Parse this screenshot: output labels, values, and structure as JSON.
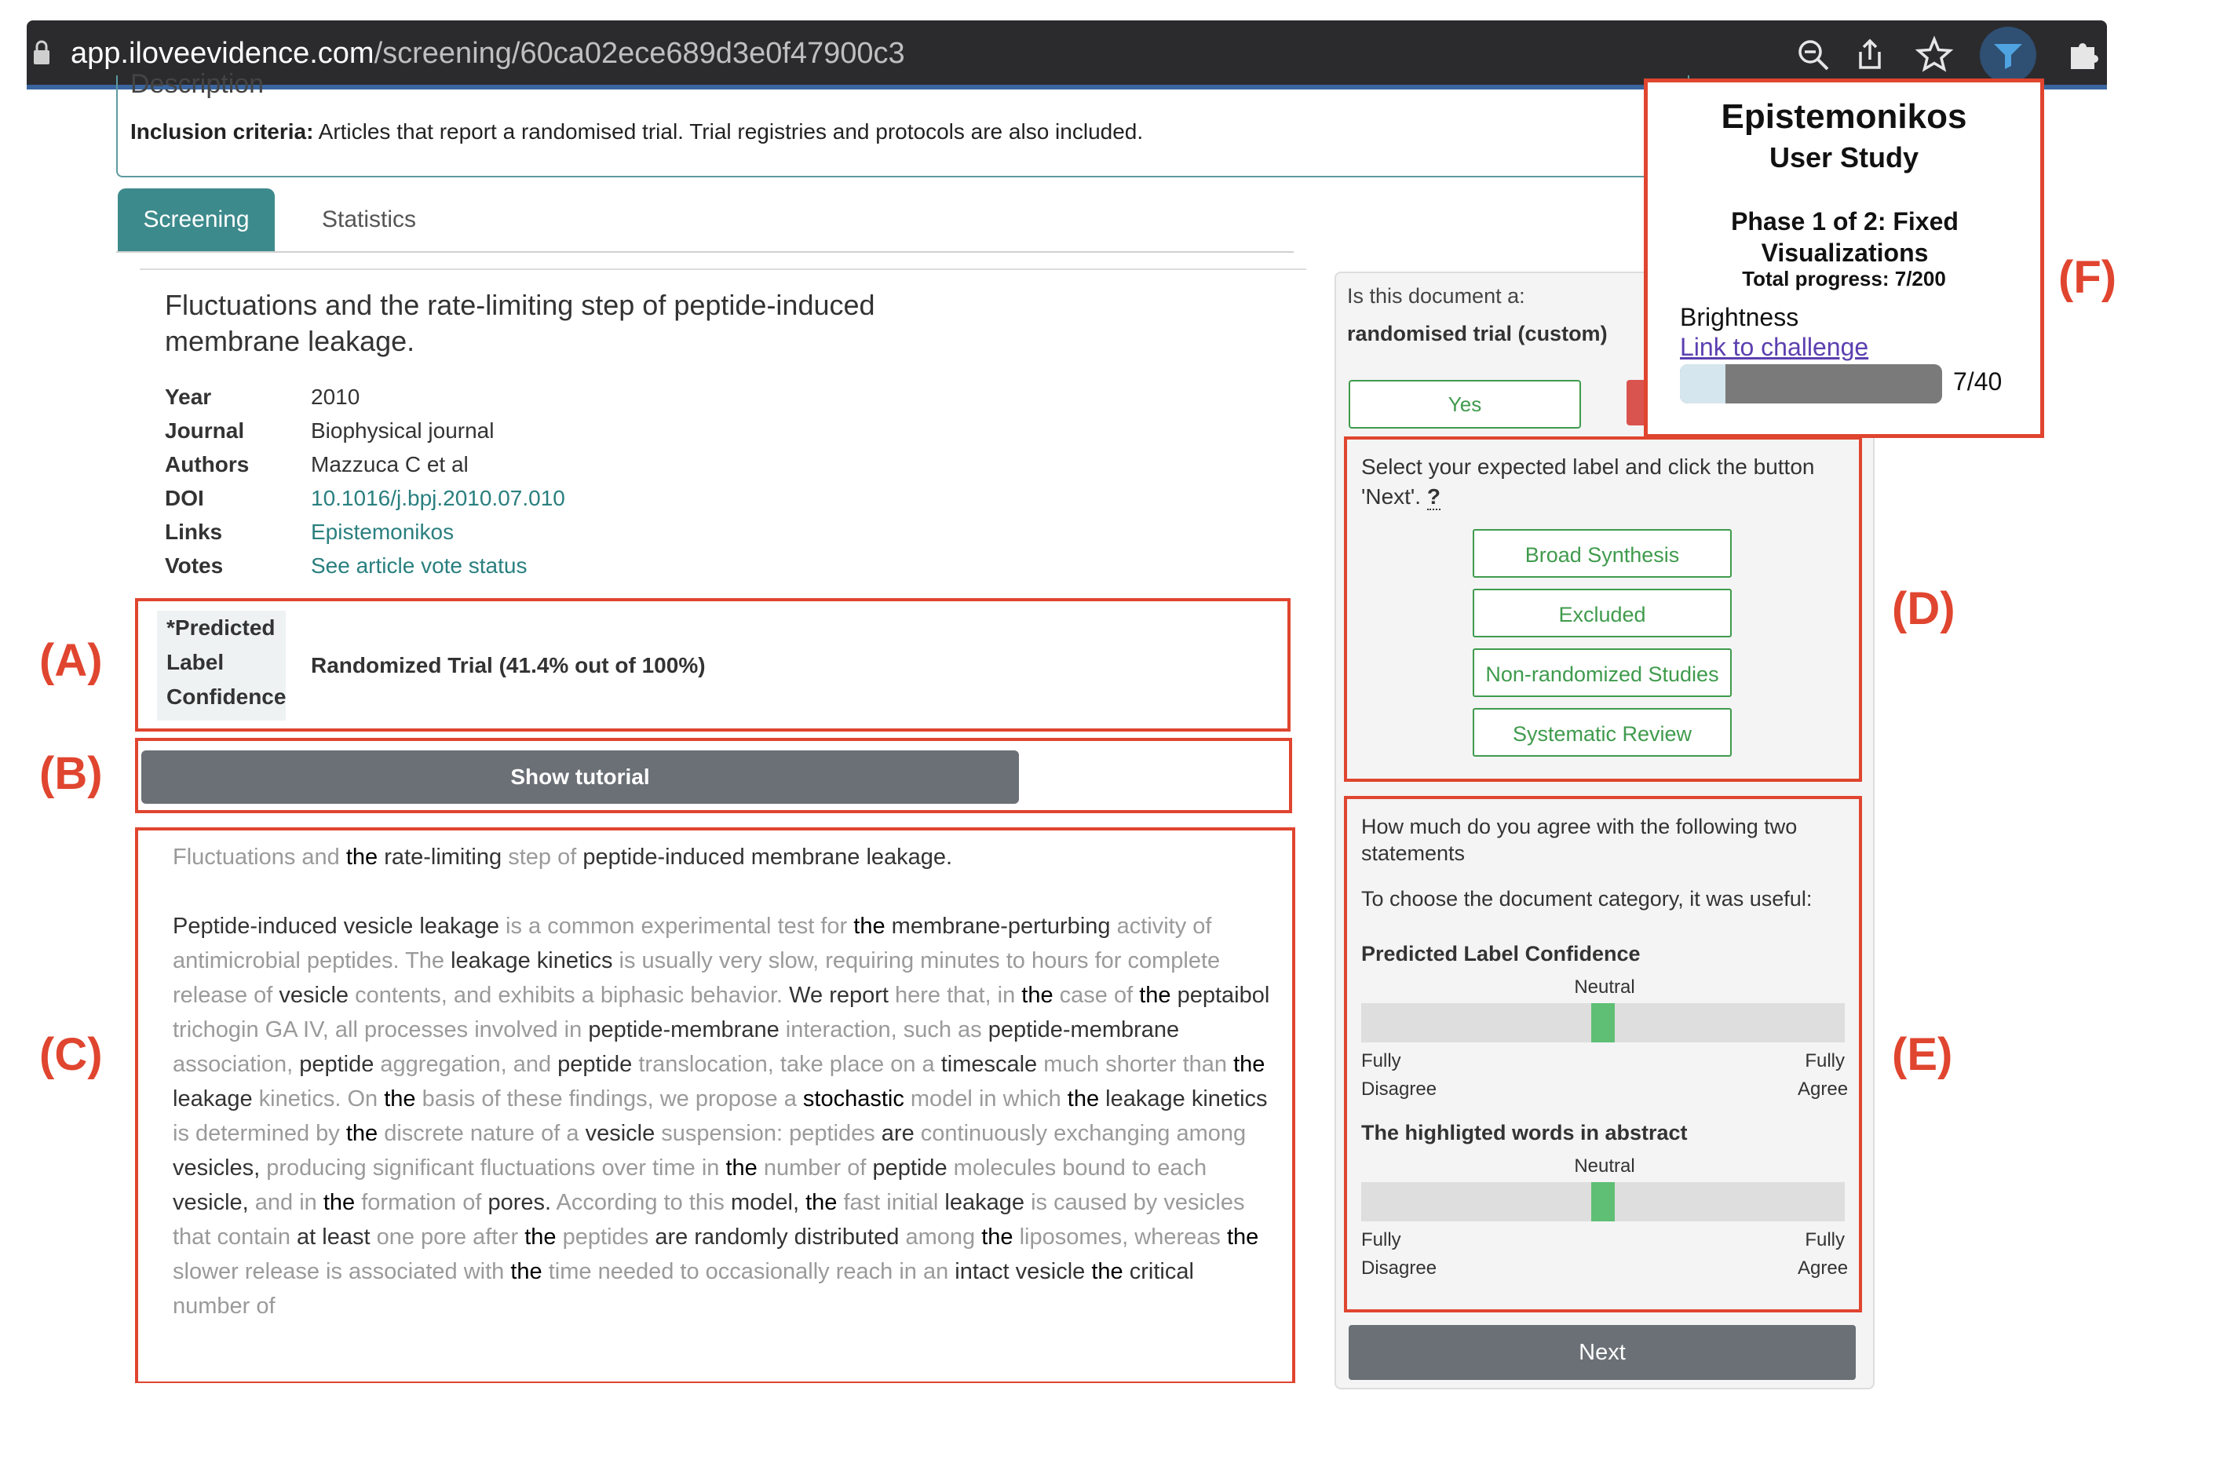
{
  "browser": {
    "url_host": "app.iloveevidence.com",
    "url_path": "/screening/60ca02ece689d3e0f47900c3",
    "toolbar_icons": [
      "zoom-out-icon",
      "share-icon",
      "star-icon",
      "extension-active-icon",
      "puzzle-icon"
    ]
  },
  "description": {
    "heading": "Description",
    "inclusion_label": "Inclusion criteria:",
    "inclusion_text": " Articles that report a randomised trial. Trial registries and protocols are also included."
  },
  "tabs": [
    {
      "label": "Screening",
      "active": true
    },
    {
      "label": "Statistics",
      "active": false
    }
  ],
  "article": {
    "title": "Fluctuations and the rate-limiting step of peptide-induced membrane leakage.",
    "meta": [
      {
        "key": "Year",
        "value": "2010",
        "link": false
      },
      {
        "key": "Journal",
        "value": "Biophysical journal",
        "link": false
      },
      {
        "key": "Authors",
        "value": "Mazzuca C et al",
        "link": false
      },
      {
        "key": "DOI",
        "value": "10.1016/j.bpj.2010.07.010",
        "link": true
      },
      {
        "key": "Links",
        "value": "Epistemonikos",
        "link": true
      },
      {
        "key": "Votes",
        "value": "See article vote status",
        "link": true
      }
    ]
  },
  "prediction": {
    "label_lines": [
      "*Predicted",
      "Label",
      "Confidence"
    ],
    "value": "Randomized Trial (41.4% out of 100%)"
  },
  "tutorial_button": "Show tutorial",
  "abstract": {
    "title": "Fluctuations and the rate-limiting step of peptide-induced membrane leakage.",
    "text": "Peptide-induced vesicle leakage is a common experimental test for the membrane-perturbing activity of antimicrobial peptides. The leakage kinetics is usually very slow, requiring minutes to hours for complete release of vesicle contents, and exhibits a biphasic behavior. We report here that, in the case of the peptaibol trichogin GA IV, all processes involved in peptide-membrane interaction, such as peptide-membrane association, peptide aggregation, and peptide translocation, take place on a timescale much shorter than the leakage kinetics. On the basis of these findings, we propose a stochastic model in which the leakage kinetics is determined by the discrete nature of a vesicle suspension: peptides are continuously exchanging among vesicles, producing significant fluctuations over time in the number of peptide molecules bound to each vesicle, and in the formation of pores. According to this model, the fast initial leakage is caused by vesicles that contain at least one pore after the peptides are randomly distributed among the liposomes, whereas the slower release is associated with the time needed to occasionally reach in an intact vesicle the critical number of",
    "highlight_strong": [
      "stochastic",
      "the"
    ],
    "highlight_dark": [
      "rate-limiting",
      "peptide-induced",
      "membrane",
      "leakage.",
      "Peptide-induced",
      "vesicle",
      "membrane-perturbing",
      "vesicle",
      "We",
      "report",
      "peptaibol",
      "peptide-membrane",
      "peptide-membrane",
      "peptide",
      "timescale",
      "leakage",
      "kinetics",
      "at",
      "least",
      "are",
      "randomly",
      "distributed",
      "vesicles,",
      "vesicle,",
      "pores.",
      "model,",
      "peptide",
      "intact",
      "vesicle",
      "critical"
    ]
  },
  "labeling": {
    "question": "Is this document a:",
    "category": "randomised trial (custom)",
    "yes_label": "Yes",
    "instruction": "Select your expected label and click the button 'Next'.",
    "help_glyph": "?",
    "options": [
      "Broad Synthesis",
      "Excluded",
      "Non-randomized Studies",
      "Systematic Review"
    ]
  },
  "survey": {
    "intro": "How much do you agree with the following two statements",
    "lead": "To choose the document category, it was useful:",
    "items": [
      {
        "title": "Predicted Label Confidence",
        "neutral": "Neutral",
        "left": [
          "Fully",
          "Disagree"
        ],
        "right": [
          "Fully",
          "Agree"
        ],
        "value": 0.5
      },
      {
        "title": "The highligted words in abstract",
        "neutral": "Neutral",
        "left": [
          "Fully",
          "Disagree"
        ],
        "right": [
          "Fully",
          "Agree"
        ],
        "value": 0.5
      }
    ],
    "next_label": "Next"
  },
  "study_overlay": {
    "title": "Epistemonikos",
    "subtitle": "User Study",
    "phase": "Phase 1 of 2: Fixed Visualizations",
    "total_progress": "Total progress: 7/200",
    "brightness_label": "Brightness",
    "link_label": "Link to challenge",
    "count": "7/40",
    "progress_fraction": 0.175
  },
  "annotations": [
    "(A)",
    "(B)",
    "(C)",
    "(D)",
    "(E)",
    "(F)"
  ],
  "colors": {
    "accent_teal": "#3d8a8c",
    "annotation_red": "#e0452f",
    "label_green": "#3f9b4d",
    "slider_green": "#5fbf74"
  }
}
